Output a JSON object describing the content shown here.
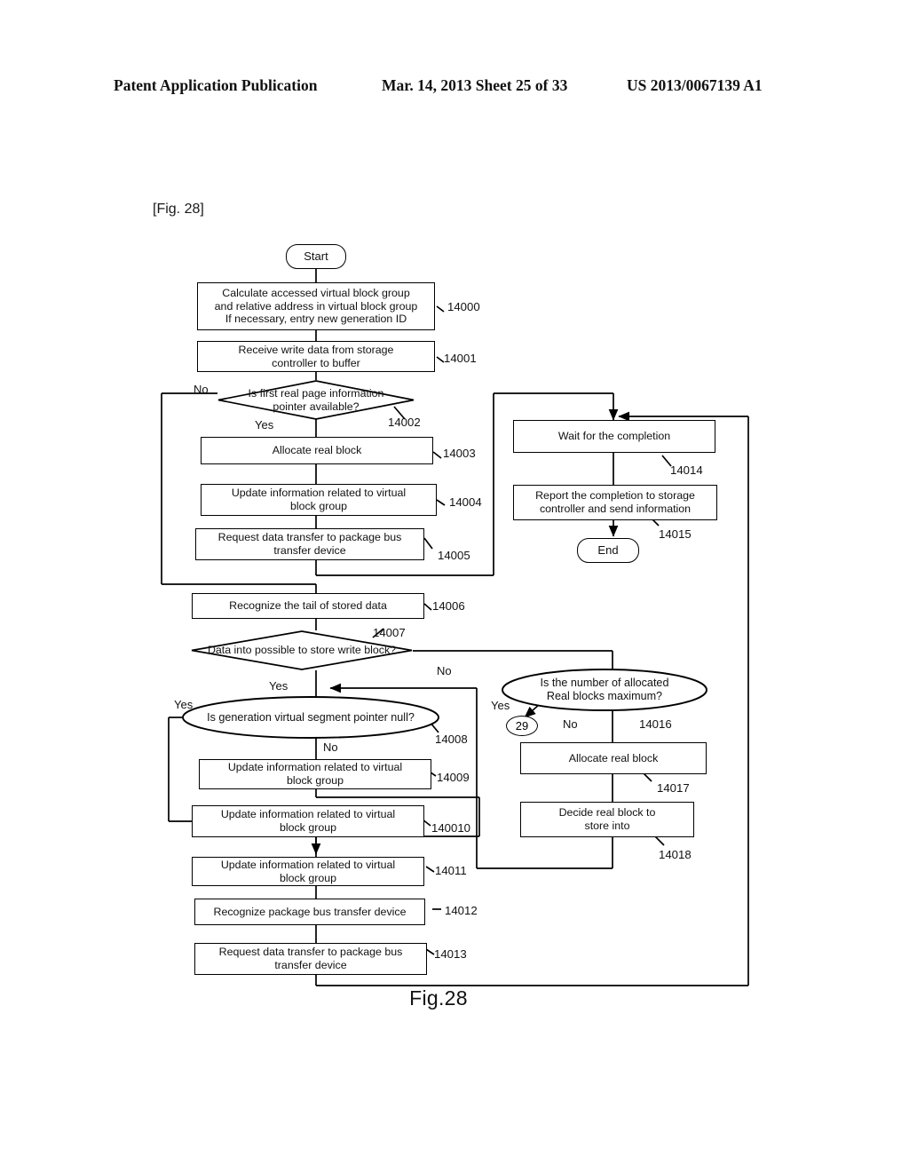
{
  "header": {
    "publication": "Patent Application Publication",
    "date_sheet": "Mar. 14, 2013  Sheet 25 of 33",
    "pub_number": "US 2013/0067139 A1"
  },
  "figure": {
    "tag": "[Fig. 28]",
    "caption": "Fig.28"
  },
  "flowchart": {
    "nodes": {
      "start": {
        "label": "Start",
        "shape": "terminator"
      },
      "n14000": {
        "label": "Calculate accessed virtual block group\nand relative address in virtual block group\nIf necessary, entry new generation ID",
        "ref": "14000",
        "shape": "process"
      },
      "n14001": {
        "label": "Receive write data from storage\ncontroller to buffer",
        "ref": "14001",
        "shape": "process"
      },
      "n14002": {
        "label": "Is first real page information\npointer available?",
        "ref": "14002",
        "shape": "decision"
      },
      "n14003": {
        "label": "Allocate real block",
        "ref": "14003",
        "shape": "process"
      },
      "n14004": {
        "label": "Update information related to virtual\nblock group",
        "ref": "14004",
        "shape": "process"
      },
      "n14005": {
        "label": "Request data transfer to package bus\ntransfer device",
        "ref": "14005",
        "shape": "process"
      },
      "n14006": {
        "label": "Recognize the tail of stored data",
        "ref": "14006",
        "shape": "process"
      },
      "n14007": {
        "label": "Data into possible to store write block?",
        "ref": "14007",
        "shape": "decision"
      },
      "n14008": {
        "label": "Is generation virtual segment pointer null?",
        "ref": "14008",
        "shape": "ellipse"
      },
      "n14009": {
        "label": "Update information related to virtual\nblock group",
        "ref": "14009",
        "shape": "process"
      },
      "n140010": {
        "label": "Update information related to virtual\nblock group",
        "ref": "140010",
        "shape": "process"
      },
      "n14011": {
        "label": "Update information related to virtual\nblock group",
        "ref": "14011",
        "shape": "process"
      },
      "n14012": {
        "label": "Recognize package bus transfer device",
        "ref": "14012",
        "shape": "process"
      },
      "n14013": {
        "label": "Request data transfer to package bus\ntransfer device",
        "ref": "14013",
        "shape": "process"
      },
      "n14014": {
        "label": "Wait for the completion",
        "ref": "14014",
        "shape": "process"
      },
      "n14015": {
        "label": "Report the completion to storage\ncontroller and send information",
        "ref": "14015",
        "shape": "process"
      },
      "end": {
        "label": "End",
        "shape": "terminator"
      },
      "n14016": {
        "label": "Is the number of allocated\nReal  blocks maximum?",
        "ref": "14016",
        "shape": "ellipse"
      },
      "n14017": {
        "label": "Allocate real block",
        "ref": "14017",
        "shape": "process"
      },
      "n14018": {
        "label": "Decide real block to\nstore into",
        "ref": "14018",
        "shape": "process"
      },
      "connector29": {
        "label": "29",
        "shape": "offpage-connector"
      }
    },
    "edge_labels": {
      "e14002_no": "No",
      "e14002_yes": "Yes",
      "e14007_no": "No",
      "e14007_yes": "Yes",
      "e14008_yes": "Yes",
      "e14008_no": "No",
      "e14016_yes": "Yes",
      "e14016_no": "No"
    }
  }
}
